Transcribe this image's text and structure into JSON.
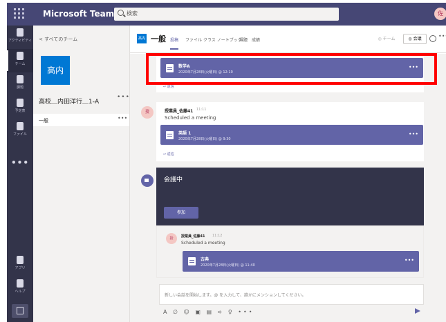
{
  "app": {
    "title": "Microsoft Teams",
    "user_initial": "佐"
  },
  "search": {
    "text": "検索"
  },
  "rail": {
    "items": [
      {
        "label": "アクティビティ"
      },
      {
        "label": "チーム"
      },
      {
        "label": "課題"
      },
      {
        "label": "予定表"
      },
      {
        "label": "ファイル"
      }
    ],
    "more": "•••",
    "store_label": "アプリ",
    "help_label": "ヘルプ"
  },
  "teams_panel": {
    "back_label": "< すべてのチーム",
    "team_tile": "高内",
    "team_name": "高校＿内田洋行＿1-A",
    "team_more": "•••",
    "channel": "一般",
    "channel_more": "•••"
  },
  "channel_header": {
    "badge": "高内",
    "title": "一般",
    "tabs": [
      "投稿",
      "ファイル",
      "クラス ノートブック",
      "課題",
      "成績"
    ],
    "team_button": "◎ チーム",
    "meet_button": "◎ 会議",
    "more": "•••"
  },
  "feed": {
    "post1": {
      "card_title": "数学A",
      "card_subtitle": "2020年7月28日(火曜日) @ 12:10",
      "reply": "↩ 返信"
    },
    "post2": {
      "avatar": "授",
      "author": "授業員_佐藤41",
      "time": "11:11",
      "status": "Scheduled a meeting",
      "card_title": "英語 1",
      "card_subtitle": "2020年7月28日(火曜日) @ 9:30",
      "reply": "↩ 返信"
    },
    "live": {
      "title": "会議中",
      "join_label": "参加"
    },
    "post3": {
      "avatar": "授",
      "author": "授業員_佐藤41",
      "time": "11:12",
      "status": "Scheduled a meeting",
      "card_title": "古典",
      "card_subtitle": "2020年7月28日(火曜日) @ 11:40"
    },
    "card_more": "•••"
  },
  "composer": {
    "placeholder": "新しい会話を開始します。@ を入力して、誰かにメンションしてください。",
    "tools": "A ∅ ☺ ▣ ▤ ➪ ♀ •••"
  },
  "colors": {
    "brand": "#6264a7",
    "header": "#464775",
    "rail": "#33344a",
    "highlight": "#ff0000"
  }
}
